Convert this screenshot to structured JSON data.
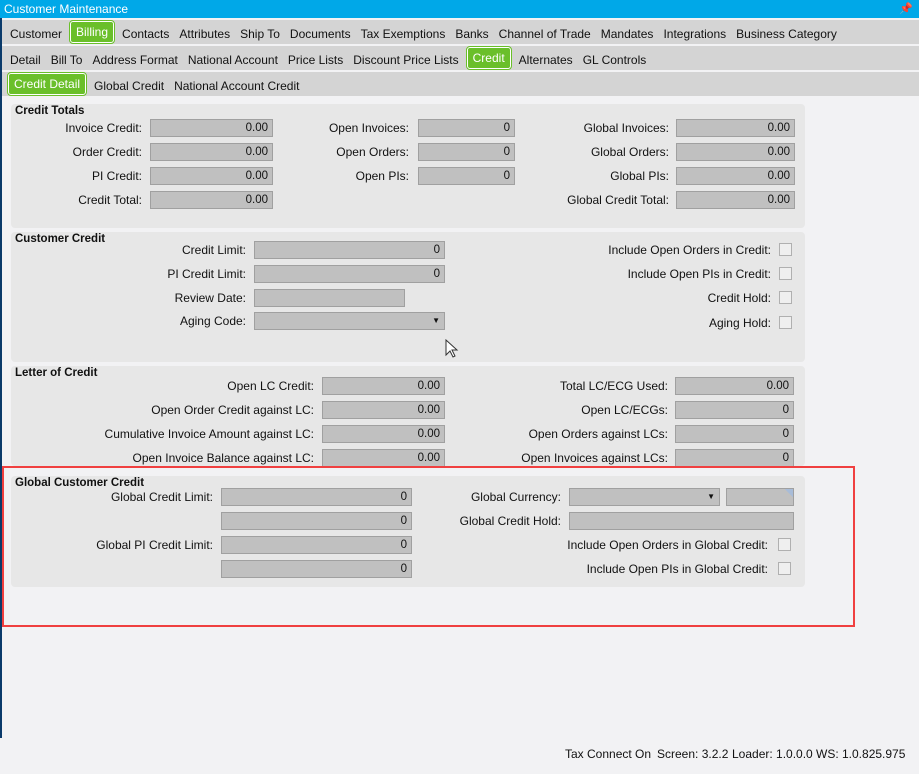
{
  "window": {
    "title": "Customer Maintenance",
    "pin_icon": "pin-icon"
  },
  "tabs1": [
    "Customer",
    "Billing",
    "Contacts",
    "Attributes",
    "Ship To",
    "Documents",
    "Tax Exemptions",
    "Banks",
    "Channel of Trade",
    "Mandates",
    "Integrations",
    "Business Category"
  ],
  "tabs2": [
    "Detail",
    "Bill To",
    "Address Format",
    "National Account",
    "Price Lists",
    "Discount Price Lists",
    "Credit",
    "Alternates",
    "GL Controls"
  ],
  "tabs3": [
    "Credit Detail",
    "Global Credit",
    "National Account Credit"
  ],
  "credit_totals": {
    "title": "Credit Totals",
    "invoice_credit": {
      "label": "Invoice Credit:",
      "value": "0.00"
    },
    "order_credit": {
      "label": "Order Credit:",
      "value": "0.00"
    },
    "pi_credit": {
      "label": "PI Credit:",
      "value": "0.00"
    },
    "credit_total": {
      "label": "Credit Total:",
      "value": "0.00"
    },
    "open_invoices": {
      "label": "Open Invoices:",
      "value": "0"
    },
    "open_orders": {
      "label": "Open Orders:",
      "value": "0"
    },
    "open_pis": {
      "label": "Open PIs:",
      "value": "0"
    },
    "global_invoices": {
      "label": "Global Invoices:",
      "value": "0.00"
    },
    "global_orders": {
      "label": "Global Orders:",
      "value": "0.00"
    },
    "global_pis": {
      "label": "Global PIs:",
      "value": "0.00"
    },
    "global_credit_total": {
      "label": "Global Credit Total:",
      "value": "0.00"
    }
  },
  "customer_credit": {
    "title": "Customer Credit",
    "credit_limit": {
      "label": "Credit Limit:",
      "value": "0"
    },
    "pi_credit_limit": {
      "label": "PI Credit Limit:",
      "value": "0"
    },
    "review_date": {
      "label": "Review Date:",
      "value": ""
    },
    "aging_code": {
      "label": "Aging Code:",
      "value": ""
    },
    "include_open_orders": {
      "label": "Include Open Orders in Credit:",
      "checked": false
    },
    "include_open_pis": {
      "label": "Include Open PIs in Credit:",
      "checked": false
    },
    "credit_hold": {
      "label": "Credit Hold:",
      "checked": false
    },
    "aging_hold": {
      "label": "Aging Hold:",
      "checked": false
    }
  },
  "letter_of_credit": {
    "title": "Letter of Credit",
    "open_lc_credit": {
      "label": "Open LC Credit:",
      "value": "0.00"
    },
    "open_order_credit_lc": {
      "label": "Open Order Credit against LC:",
      "value": "0.00"
    },
    "cum_invoice_lc": {
      "label": "Cumulative Invoice Amount against LC:",
      "value": "0.00"
    },
    "open_invoice_balance_lc": {
      "label": "Open Invoice Balance against LC:",
      "value": "0.00"
    },
    "total_lc_used": {
      "label": "Total LC/ECG Used:",
      "value": "0.00"
    },
    "open_lc_ecgs": {
      "label": "Open LC/ECGs:",
      "value": "0"
    },
    "open_orders_lcs": {
      "label": "Open Orders against LCs:",
      "value": "0"
    },
    "open_invoices_lcs": {
      "label": "Open Invoices against LCs:",
      "value": "0"
    }
  },
  "global_customer_credit": {
    "title": "Global Customer Credit",
    "global_credit_limit": {
      "label": "Global Credit Limit:",
      "value": "0",
      "value2": "0"
    },
    "global_pi_credit_limit": {
      "label": "Global PI Credit Limit:",
      "value": "0",
      "value2": "0"
    },
    "global_currency": {
      "label": "Global Currency:",
      "value": ""
    },
    "global_credit_hold": {
      "label": "Global Credit Hold:",
      "value": ""
    },
    "include_open_orders": {
      "label": "Include Open Orders in Global Credit:",
      "checked": false
    },
    "include_open_pis": {
      "label": "Include Open PIs in Global Credit:",
      "checked": false
    }
  },
  "status": {
    "tax_connect": "Tax Connect On",
    "screen": "Screen: 3.2.2",
    "loader": "Loader: 1.0.0.0",
    "ws": "WS: 1.0.825.975"
  },
  "colors": {
    "titlebar": "#00a8e8",
    "active_tab": "#6abf2a",
    "highlight": "#f04040"
  }
}
